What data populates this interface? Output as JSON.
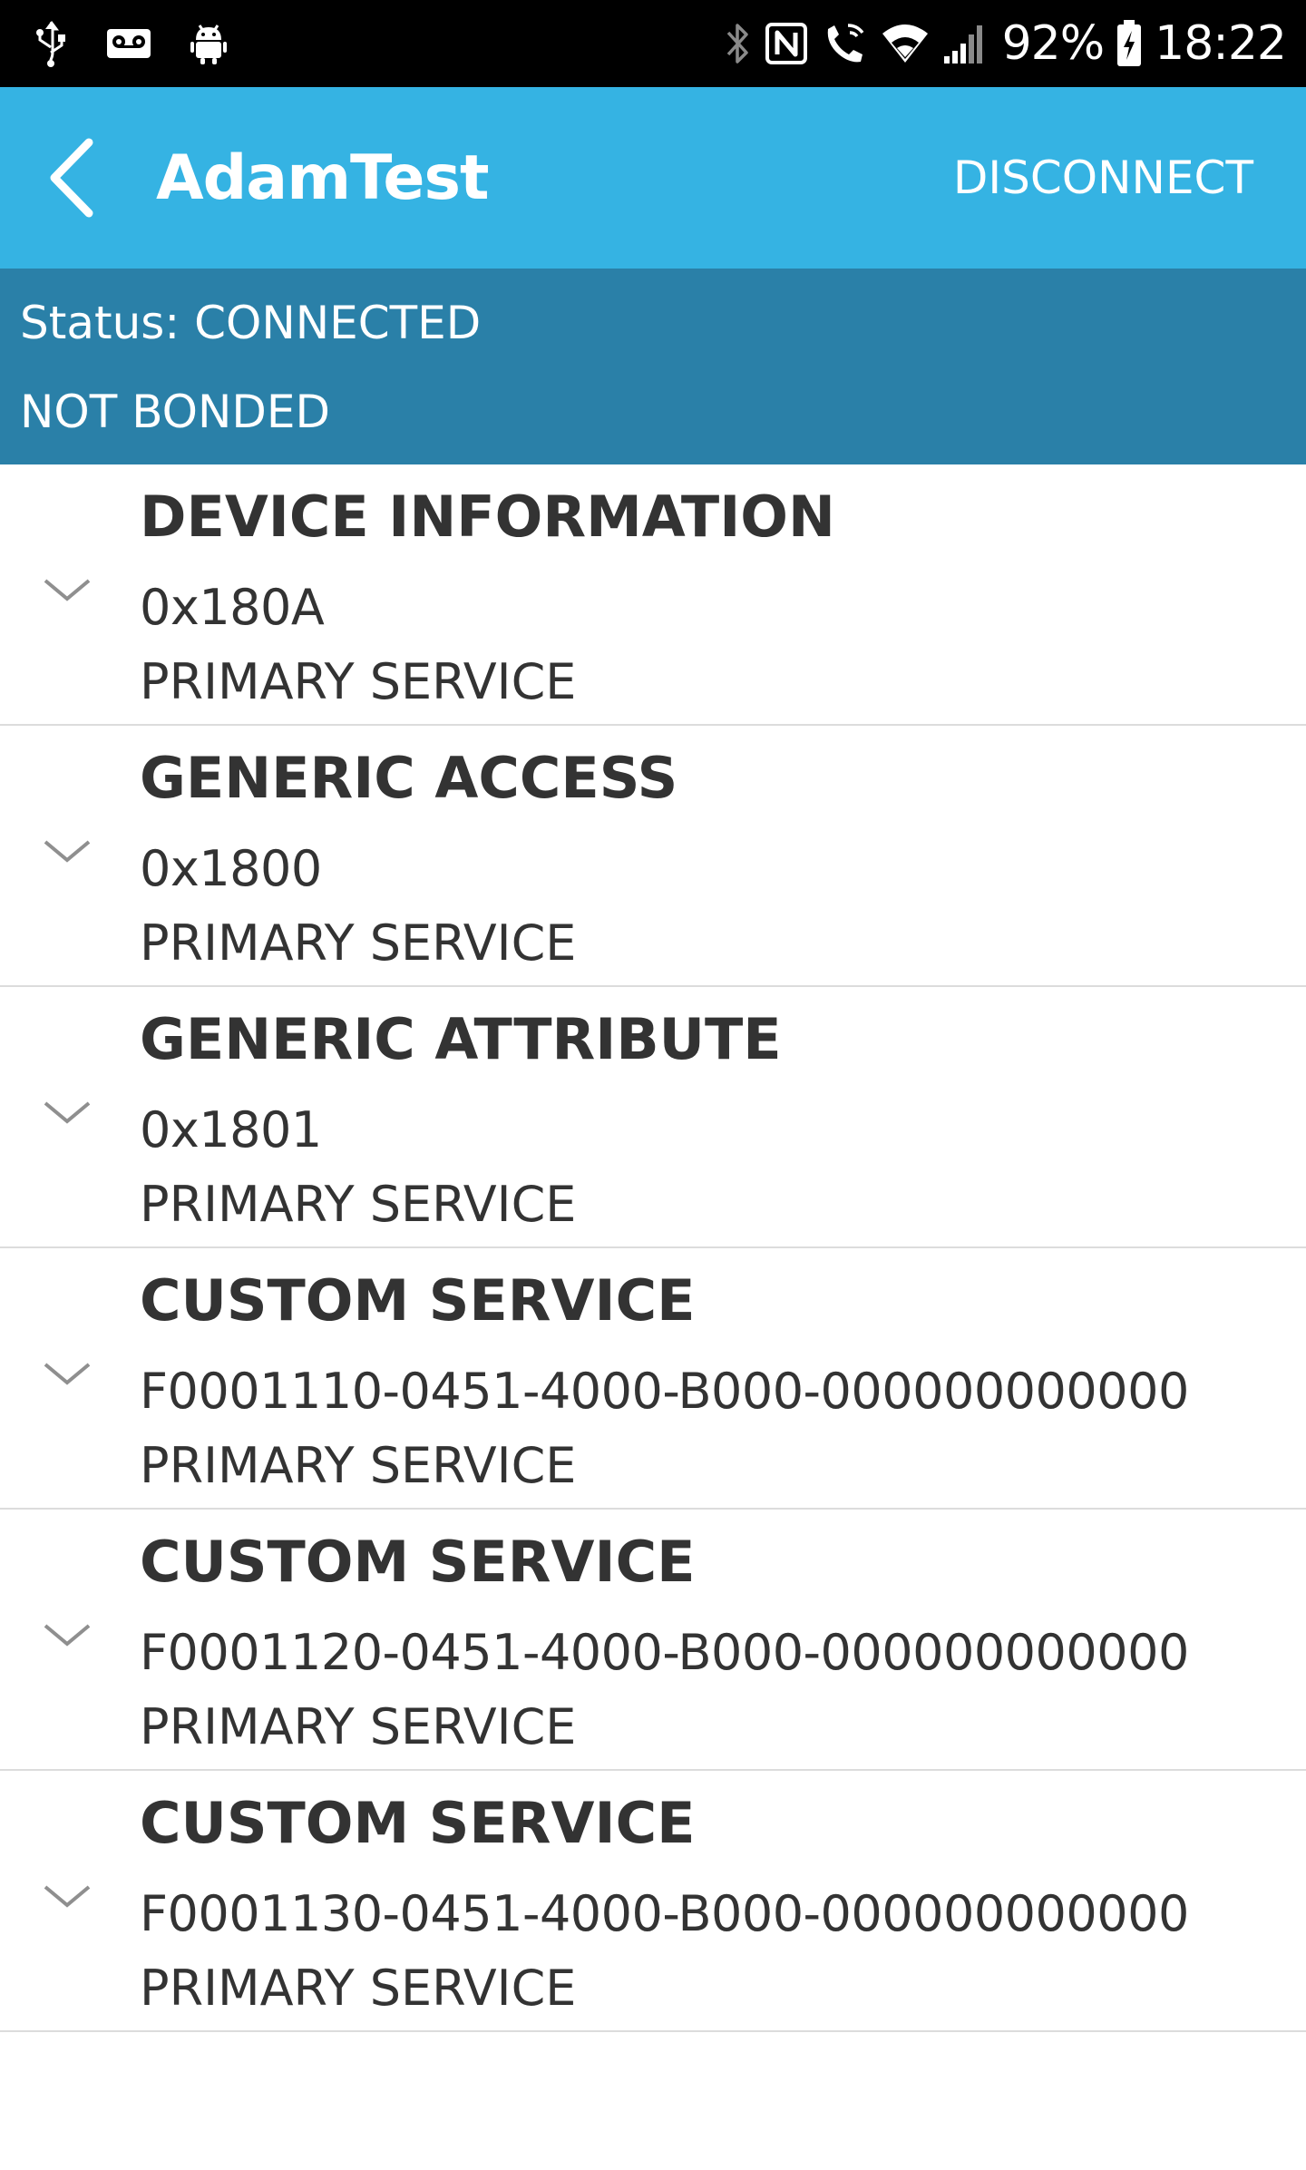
{
  "status_bar": {
    "left_icons": [
      "usb-icon",
      "voicemail-icon",
      "android-debug-icon"
    ],
    "right_icons": [
      "bluetooth-icon",
      "nfc-icon",
      "wifi-calling-icon",
      "wifi-icon",
      "signal-icon"
    ],
    "battery_percent": "92%",
    "battery_icon": "battery-charging-icon",
    "time": "18:22"
  },
  "app_bar": {
    "back_icon": "chevron-left-icon",
    "title": "AdamTest",
    "disconnect_label": "DISCONNECT",
    "background_color": "#35b3e3"
  },
  "status_panel": {
    "status_text": "Status: CONNECTED",
    "bond_text": "NOT BONDED",
    "background_color": "#2a80a8"
  },
  "services": [
    {
      "name": "DEVICE INFORMATION",
      "uuid": "0x180A",
      "type": "PRIMARY SERVICE",
      "icon": "chevron-down-icon"
    },
    {
      "name": "GENERIC ACCESS",
      "uuid": "0x1800",
      "type": "PRIMARY SERVICE",
      "icon": "chevron-down-icon"
    },
    {
      "name": "GENERIC ATTRIBUTE",
      "uuid": "0x1801",
      "type": "PRIMARY SERVICE",
      "icon": "chevron-down-icon"
    },
    {
      "name": "CUSTOM SERVICE",
      "uuid": "F0001110-0451-4000-B000-000000000000",
      "type": "PRIMARY SERVICE",
      "icon": "chevron-down-icon"
    },
    {
      "name": "CUSTOM SERVICE",
      "uuid": "F0001120-0451-4000-B000-000000000000",
      "type": "PRIMARY SERVICE",
      "icon": "chevron-down-icon"
    },
    {
      "name": "CUSTOM SERVICE",
      "uuid": "F0001130-0451-4000-B000-000000000000",
      "type": "PRIMARY SERVICE",
      "icon": "chevron-down-icon"
    }
  ]
}
